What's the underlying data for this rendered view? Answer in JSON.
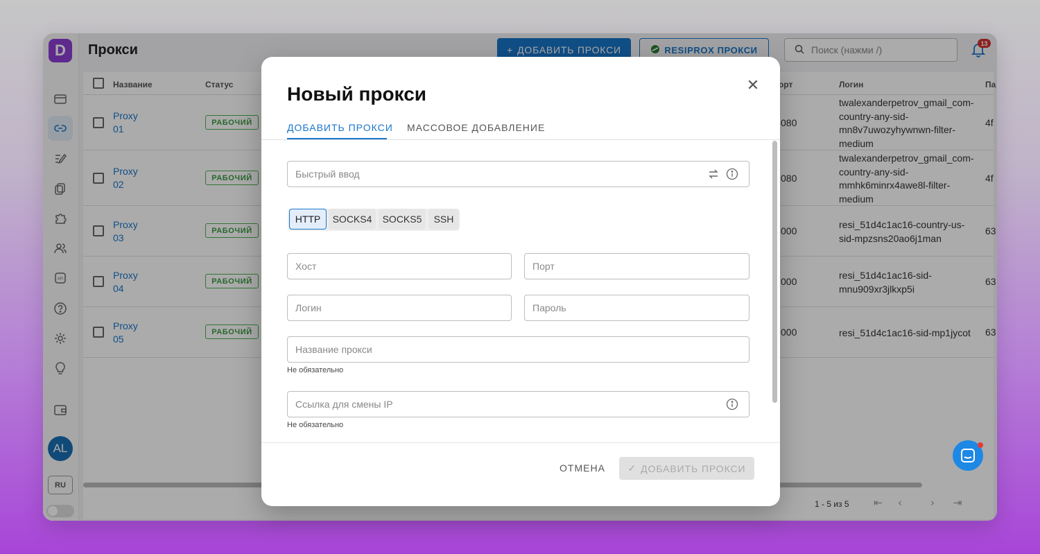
{
  "app": {
    "logo_letter": "D",
    "page_title": "Прокси"
  },
  "sidebar": {
    "icons": [
      "dashboard-icon",
      "link-icon",
      "profile-edit-icon",
      "copy-icon",
      "extension-icon",
      "users-icon",
      "api-icon",
      "help-icon",
      "settings-icon",
      "bulb-icon",
      "wallet-icon"
    ],
    "avatar": "AL",
    "lang": "RU"
  },
  "toolbar": {
    "add_label": "ДОБАВИТЬ ПРОКСИ",
    "resiprox_label": "RESIPROX ПРОКСИ",
    "search_placeholder": "Поиск (нажми /)",
    "notifications": "13"
  },
  "table": {
    "columns": {
      "name": "Название",
      "status": "Статус",
      "port": "орт",
      "login": "Логин",
      "password": "Па"
    },
    "rows": [
      {
        "name": "Proxy 01",
        "status": "РАБОЧИЙ",
        "port": "080",
        "login": "twalexanderpetrov_gmail_com-country-any-sid-mn8v7uwozyhywnwn-filter-medium",
        "password": "4f"
      },
      {
        "name": "Proxy 02",
        "status": "РАБОЧИЙ",
        "port": "080",
        "login": "twalexanderpetrov_gmail_com-country-any-sid-mmhk6minrx4awe8l-filter-medium",
        "password": "4f"
      },
      {
        "name": "Proxy 03",
        "status": "РАБОЧИЙ",
        "port": "000",
        "login": "resi_51d4c1ac16-country-us-sid-mpzsns20ao6j1man",
        "password": "63"
      },
      {
        "name": "Proxy 04",
        "status": "РАБОЧИЙ",
        "port": "000",
        "login": "resi_51d4c1ac16-sid-mnu909xr3jlkxp5i",
        "password": "63"
      },
      {
        "name": "Proxy 05",
        "status": "РАБОЧИЙ",
        "port": "000",
        "login": "resi_51d4c1ac16-sid-mp1jycot",
        "password": "63"
      }
    ],
    "pagination": "1 - 5 из 5"
  },
  "modal": {
    "title": "Новый прокси",
    "tabs": [
      "ДОБАВИТЬ ПРОКСИ",
      "МАССОВОЕ ДОБАВЛЕНИЕ"
    ],
    "quick_input_placeholder": "Быстрый ввод",
    "protocols": [
      "HTTP",
      "SOCKS4",
      "SOCKS5",
      "SSH"
    ],
    "selected_protocol": "HTTP",
    "host_placeholder": "Хост",
    "port_placeholder": "Порт",
    "login_placeholder": "Логин",
    "password_placeholder": "Пароль",
    "name_placeholder": "Название прокси",
    "name_helper": "Не обязательно",
    "ip_link_placeholder": "Ссылка для смены IP",
    "ip_link_helper": "Не обязательно",
    "cancel_label": "ОТМЕНА",
    "submit_label": "ДОБАВИТЬ ПРОКСИ"
  },
  "colors": {
    "accent": "#1976c9",
    "brand": "#8e3fd2",
    "status_ok": "#4caf50",
    "badge": "#d32f2f"
  }
}
